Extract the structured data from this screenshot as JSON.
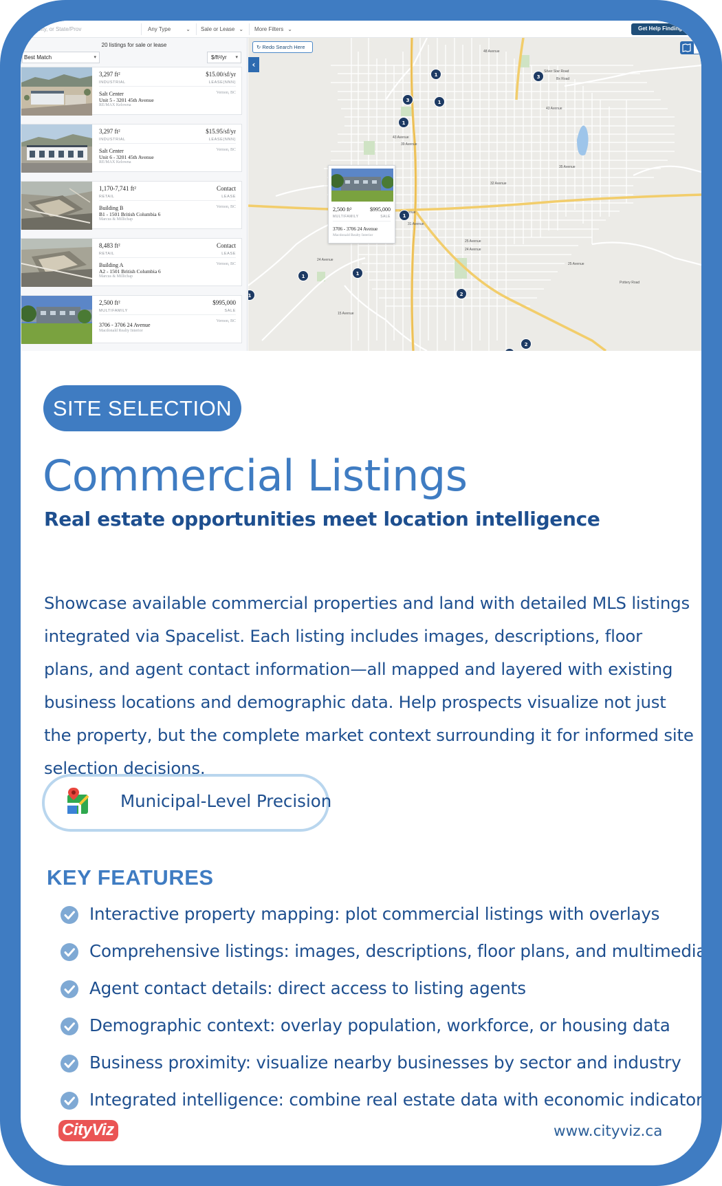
{
  "app": {
    "filters": {
      "search_placeholder": "City, or State/Prov",
      "type": "Any Type",
      "mode": "Sale or Lease",
      "more": "More Filters",
      "help": "Get Help Finding"
    },
    "list": {
      "count": "20 listings for sale or lease",
      "sort": "Best Match",
      "unit": "$/ft²/yr"
    },
    "listings": [
      {
        "size": "3,297 ft²",
        "type": "INDUSTRIAL",
        "price": "$15.00/sf/yr",
        "mode": "LEASE(NNN)",
        "name": "Salt Center",
        "address": "Unit 5 - 3201 45th Avenue",
        "broker": "RE/MAX Kelowna",
        "city": "Vernon, BC"
      },
      {
        "size": "3,297 ft²",
        "type": "INDUSTRIAL",
        "price": "$15.95/sf/yr",
        "mode": "LEASE(NNN)",
        "name": "Salt Center",
        "address": "Unit 6 - 3201 45th Avenue",
        "broker": "RE/MAX Kelowna",
        "city": "Vernon, BC"
      },
      {
        "size": "1,170-7,741 ft²",
        "type": "RETAIL",
        "price": "Contact",
        "mode": "LEASE",
        "name": "Building B",
        "address": "B1 - 1501 British Columbia 6",
        "broker": "Marcus & Millichap",
        "city": "Vernon, BC"
      },
      {
        "size": "8,483 ft²",
        "type": "RETAIL",
        "price": "Contact",
        "mode": "LEASE",
        "name": "Building A",
        "address": "A2 - 1501 British Columbia 6",
        "broker": "Marcus & Millichap",
        "city": "Vernon, BC"
      },
      {
        "size": "2,500 ft²",
        "type": "MULTIFAMILY",
        "price": "$995,000",
        "mode": "SALE",
        "name": "",
        "address": "3706 - 3706 24 Avenue",
        "broker": "Macdonald Realty Interior",
        "city": "Vernon, BC"
      }
    ],
    "map": {
      "redo": "Redo Search Here",
      "popup": {
        "size": "2,500 ft²",
        "price": "$995,000",
        "type": "MULTIFAMILY",
        "mode": "SALE",
        "address": "3706 - 3706 24 Avenue",
        "broker": "Macdonald Realty Interior"
      },
      "pins": [
        "1",
        "3",
        "1",
        "3",
        "1",
        "1",
        "1",
        "1",
        "2",
        "2",
        "2",
        "1"
      ],
      "street_labels": [
        "48 Avenue",
        "Bx Road",
        "43 Avenue",
        "39 Avenue",
        "35 Avenue",
        "32 Avenue",
        "30 Avenue",
        "25 Avenue",
        "24 Avenue",
        "Pottery Road",
        "24 Avenue",
        "15 Avenue",
        "31 Avenue",
        "Silver Star Road",
        "43 Avenue",
        "25 Avenue"
      ]
    }
  },
  "content": {
    "tag": "SITE SELECTION",
    "title": "Commercial Listings",
    "subtitle": "Real estate opportunities meet location intelligence",
    "description": "Showcase available commercial properties and land with detailed MLS listings integrated via Spacelist. Each listing includes images, descriptions, floor plans, and agent contact information—all mapped and layered with existing business locations and demographic data. Help prospects visualize not just the property, but the complete market context surrounding it for informed site selection decisions.",
    "badge": "Municipal-Level Precision",
    "features_heading": "KEY FEATURES",
    "features": [
      "Interactive property mapping: plot commercial listings with overlays",
      "Comprehensive listings: images, descriptions, floor plans, and multimedia",
      "Agent contact details: direct access to listing agents",
      "Demographic context: overlay population, workforce, or housing data",
      "Business proximity: visualize nearby businesses by sector and industry",
      "Integrated intelligence: combine real estate data with economic indicators"
    ]
  },
  "footer": {
    "logo": "CityViz",
    "website": "www.cityviz.ca"
  },
  "colors": {
    "brand_blue": "#3f7cc2",
    "text_navy": "#1e4f8f",
    "logo_red": "#ea5555"
  }
}
